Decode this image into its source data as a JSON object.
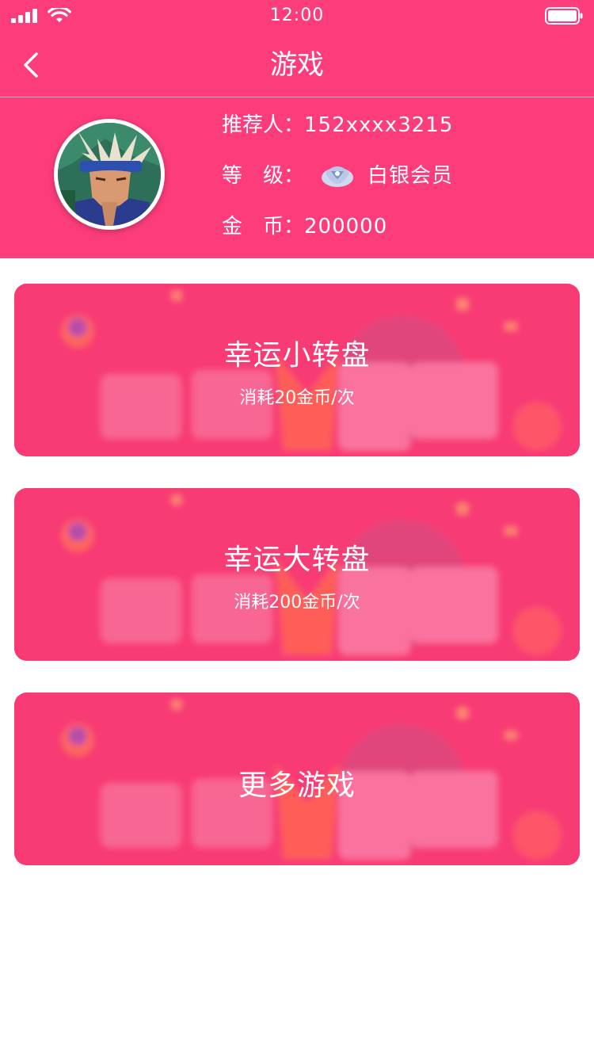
{
  "status_bar": {
    "time": "12:00"
  },
  "nav": {
    "title": "游戏"
  },
  "profile": {
    "referrer_label": "推荐人：",
    "referrer_value": "152xxxx3215",
    "level_label": "等　级：",
    "level_value": "白银会员",
    "coins_label": "金　币：",
    "coins_value": "200000"
  },
  "games": [
    {
      "title": "幸运小转盘",
      "subtitle": "消耗20金币/次"
    },
    {
      "title": "幸运大转盘",
      "subtitle": "消耗200金币/次"
    },
    {
      "title": "更多游戏"
    }
  ],
  "colors": {
    "brand": "#fd3c7b",
    "card": "#f9376f",
    "text_light": "#ffffff"
  }
}
